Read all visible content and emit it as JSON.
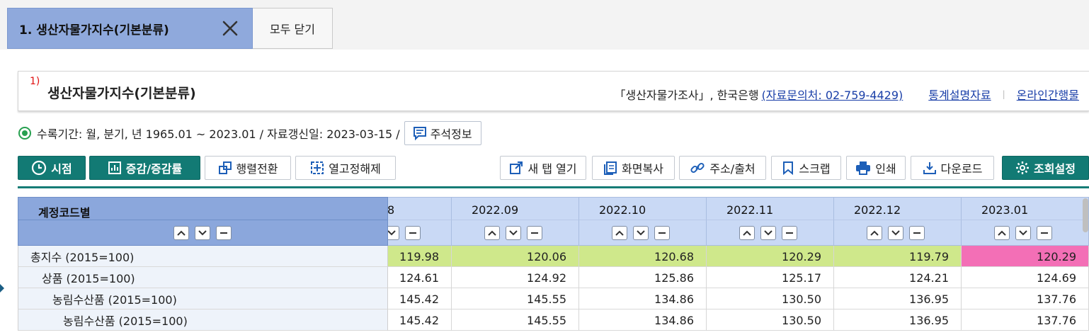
{
  "tabs": {
    "active_label": "1. 생산자물가지수(기본분류)",
    "close_all_label": "모두 닫기"
  },
  "title": {
    "number": "1)",
    "text": "생산자물가지수(기본분류)",
    "source": "「생산자물가조사」, 한국은행",
    "contact": "(자료문의처: 02-759-4429)",
    "link_stats": "통계설명자료",
    "link_online": "온라인간행물"
  },
  "info": {
    "period_text": "수록기간: 월, 분기, 년 1965.01 ~ 2023.01 / 자료갱신일: 2023-03-15 /",
    "notes_button": "주석정보"
  },
  "toolbar": {
    "time_button": "시점",
    "change_button": "증감/증감률",
    "pivot_button": "행렬전환",
    "unfreeze_button": "열고정해제",
    "new_tab_button": "새 탭 열기",
    "screen_copy_button": "화면복사",
    "address_button": "주소/출처",
    "scrap_button": "스크랩",
    "print_button": "인쇄",
    "download_button": "다운로드",
    "settings_button": "조회설정"
  },
  "table": {
    "row_header_title": "계정코드별",
    "columns": [
      "8",
      "2022.09",
      "2022.10",
      "2022.11",
      "2022.12",
      "2023.01"
    ],
    "rows": [
      {
        "label": "총지수 (2015=100)",
        "values": [
          "119.98",
          "120.06",
          "120.68",
          "120.29",
          "119.79",
          "120.29"
        ]
      },
      {
        "label": "상품 (2015=100)",
        "values": [
          "124.61",
          "124.92",
          "125.86",
          "125.17",
          "124.21",
          "124.69"
        ]
      },
      {
        "label": "농림수산품 (2015=100)",
        "values": [
          "145.42",
          "145.55",
          "134.86",
          "130.50",
          "136.95",
          "137.76"
        ]
      },
      {
        "label": "농림수산품 (2015=100)",
        "values": [
          "145.42",
          "145.55",
          "134.86",
          "130.50",
          "136.95",
          "137.76"
        ]
      }
    ]
  },
  "colors": {
    "header_blue": "#8ba7dc",
    "teal": "#127a74",
    "highlight_green": "#cfe88b",
    "highlight_pink": "#f36fb6"
  }
}
